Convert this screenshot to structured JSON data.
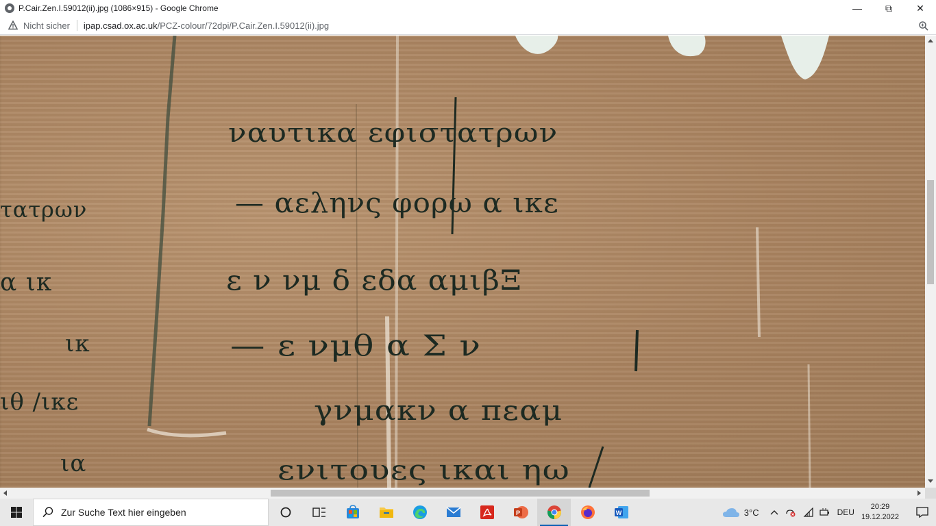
{
  "window": {
    "title": "P.Cair.Zen.I.59012(ii).jpg (1086×915) - Google Chrome",
    "controls": {
      "minimize": "—",
      "restore": "⧉",
      "close": "✕"
    }
  },
  "addressbar": {
    "security_label": "Nicht sicher",
    "domain": "ipap.csad.ox.ac.uk",
    "path": "/PCZ-colour/72dpi/P.Cair.Zen.I.59012(ii).jpg",
    "zoom_icon": "zoom-icon"
  },
  "image": {
    "description_text_lines": [
      "ναυτικα εφιστατρων",
      "— αεληνς φορω  α ικε",
      "ε ν νμ  δ εδα αμιβΞ",
      "— ε νμθ  α  Σ   ν",
      "γνμακν   α πεαμ",
      "ενιτουες ικαι ηω"
    ],
    "left_fragments": [
      "τατρων",
      "α  ικ",
      "ικ",
      "ιθ /ικε",
      "ια"
    ]
  },
  "taskbar": {
    "search_placeholder": "Zur Suche Text hier eingeben",
    "weather": "3°C",
    "language": "DEU",
    "time": "20:29",
    "date": "19.12.2022",
    "apps": [
      "task-view",
      "widgets",
      "store",
      "file-explorer",
      "edge",
      "mail",
      "acrobat",
      "powerpoint",
      "chrome",
      "firefox",
      "word"
    ]
  },
  "colors": {
    "papyrus": "#b08a66",
    "ink": "#1d2a22",
    "taskbar": "#e8e8e8",
    "chrome_active": "#0a5fb4"
  }
}
